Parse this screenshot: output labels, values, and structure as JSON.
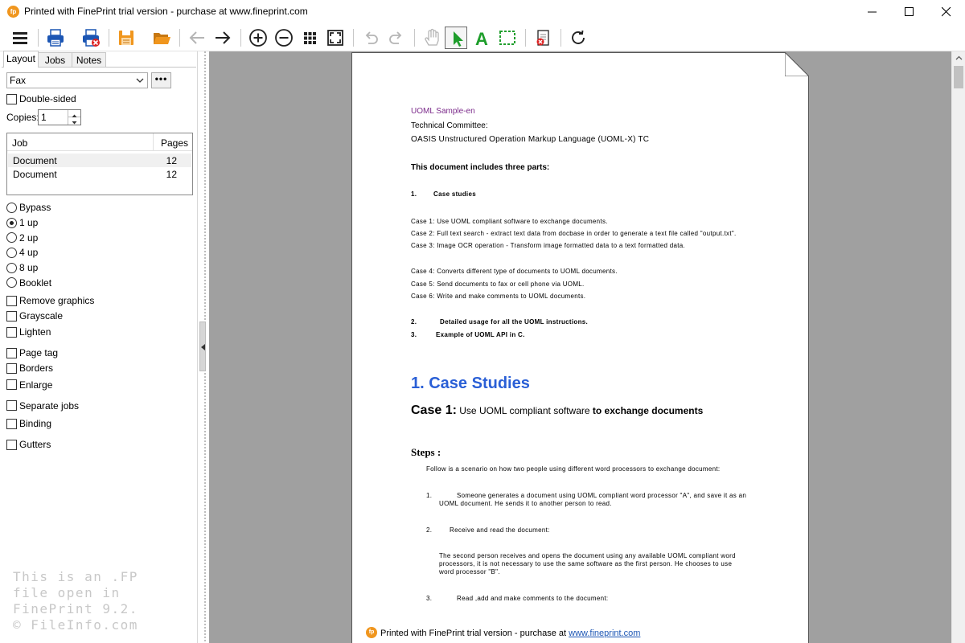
{
  "window": {
    "app_icon": "fp",
    "title": "Printed with FinePrint trial version - purchase at www.fineprint.com",
    "controls": [
      "minimize-icon",
      "maximize-icon",
      "close-icon"
    ]
  },
  "toolbar": {
    "buttons": [
      {
        "name": "menu",
        "icon": "hamburger-icon"
      },
      {
        "name": "print",
        "icon": "printer-icon"
      },
      {
        "name": "print-delete",
        "icon": "printer-x-icon"
      },
      {
        "name": "save",
        "icon": "floppy-icon"
      },
      {
        "name": "open",
        "icon": "folder-open-icon"
      },
      {
        "name": "back",
        "icon": "arrow-left-icon",
        "disabled": true
      },
      {
        "name": "forward",
        "icon": "arrow-right-icon"
      },
      {
        "name": "zoom-in",
        "icon": "zoom-in-icon"
      },
      {
        "name": "zoom-out",
        "icon": "zoom-out-icon"
      },
      {
        "name": "thumbnails",
        "icon": "grid-icon"
      },
      {
        "name": "fit-page",
        "icon": "fit-page-icon"
      },
      {
        "name": "undo",
        "icon": "undo-icon",
        "disabled": true
      },
      {
        "name": "redo",
        "icon": "redo-icon",
        "disabled": true
      },
      {
        "name": "pan",
        "icon": "hand-icon",
        "disabled": true
      },
      {
        "name": "select",
        "icon": "cursor-icon",
        "active": true
      },
      {
        "name": "add-text",
        "icon": "text-a-icon"
      },
      {
        "name": "select-area",
        "icon": "dashed-rect-icon"
      },
      {
        "name": "delete-page",
        "icon": "page-delete-icon"
      },
      {
        "name": "refresh",
        "icon": "refresh-icon"
      }
    ],
    "accent_green": "#1f9e2c",
    "accent_orange": "#f0961e",
    "accent_blue": "#1c56b4"
  },
  "sidebar": {
    "tabs": [
      "Layout",
      "Jobs",
      "Notes"
    ],
    "active_tab": "Layout",
    "printer": "Fax",
    "more_button": "•••",
    "double_sided": {
      "label": "Double-sided",
      "checked": false
    },
    "copies": {
      "label": "Copies:",
      "value": "1"
    },
    "jobs_table": {
      "columns": [
        "Job",
        "Pages"
      ],
      "rows": [
        {
          "name": "Document",
          "pages": "12",
          "selected": true
        },
        {
          "name": "Document",
          "pages": "12",
          "selected": false
        }
      ]
    },
    "layout_options": [
      {
        "label": "Bypass",
        "selected": false
      },
      {
        "label": "1 up",
        "selected": true
      },
      {
        "label": "2 up",
        "selected": false
      },
      {
        "label": "4 up",
        "selected": false
      },
      {
        "label": "8 up",
        "selected": false
      },
      {
        "label": "Booklet",
        "selected": false
      }
    ],
    "checkboxes": [
      {
        "label": "Remove graphics",
        "checked": false
      },
      {
        "label": "Grayscale",
        "checked": false
      },
      {
        "label": "Lighten",
        "checked": false
      },
      {
        "label": "Page tag",
        "checked": false
      },
      {
        "label": "Borders",
        "checked": false
      },
      {
        "label": "Enlarge",
        "checked": false
      },
      {
        "label": "Separate jobs",
        "checked": false
      },
      {
        "label": "Binding",
        "checked": false
      },
      {
        "label": "Gutters",
        "checked": false
      }
    ],
    "watermark_lines": [
      "This is an .FP",
      "file open in",
      "FinePrint 9.2.",
      "© FileInfo.com"
    ]
  },
  "document": {
    "sample_title": "UOML Sample-en",
    "sample_title_color": "#7b2a8a",
    "committee": "Technical Committee:",
    "tc_name": "OASIS Unstructured Operation Markup Language (UOML-X) TC",
    "parts_intro": "This document includes three parts:",
    "part1_num": "1.",
    "part1": "Case studies",
    "cases_a": [
      "Case 1: Use UOML compliant software to exchange documents.",
      "Case 2: Full text search - extract text data from docbase in order to generate a text file called \"output.txt\".",
      "Case 3: Image OCR operation - Transform image formatted data to a text formatted data."
    ],
    "cases_b": [
      "Case 4: Converts different type of documents to UOML documents.",
      "Case 5: Send documents to fax or cell phone via UOML.",
      "Case 6: Write and make comments to UOML documents."
    ],
    "part2_num": "2.",
    "part2": "Detailed usage for all the UOML instructions.",
    "part3_num": "3.",
    "part3": "Example of UOML API in C.",
    "heading": "1. Case Studies",
    "heading_color": "#2a5fd6",
    "case1_prefix": "Case 1:",
    "case1_mid": "Use UOML compliant software",
    "case1_end": "to exchange documents",
    "steps_heading": "Steps :",
    "steps_intro": "Follow is a scenario on how two people using different word processors to exchange document:",
    "step1_num": "1.",
    "step1_line1": "Someone generates a document using UOML compliant word processor \"A\", and save it as an",
    "step1_line2": "UOML document. He sends it to another person to read.",
    "step2_num": "2.",
    "step2": "Receive and read the document:",
    "step2_para_line1": "The second person receives and opens the document using any available UOML compliant word",
    "step2_para_line2": "processors, it is not necessary to use the same software as the first person. He chooses to use",
    "step2_para_line3": "word processor \"B\".",
    "step3_num": "3.",
    "step3": "Read ,add and make comments to the document:",
    "footer_icon": "fp",
    "footer_text": "Printed with FinePrint trial version - purchase at ",
    "footer_link": "www.fineprint.com"
  }
}
